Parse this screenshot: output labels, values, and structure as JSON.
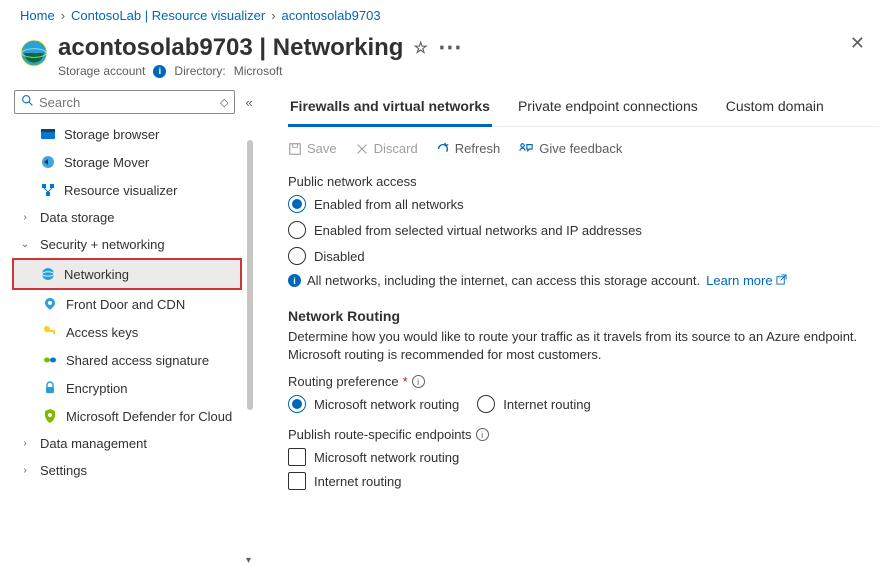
{
  "breadcrumb": {
    "home": "Home",
    "group": "ContosoLab | Resource visualizer",
    "resource": "acontosolab9703"
  },
  "header": {
    "title": "acontosolab9703 | Networking",
    "subtitle": "Storage account",
    "directory_label": "Directory:",
    "directory_value": "Microsoft"
  },
  "search": {
    "placeholder": "Search"
  },
  "sidebar": {
    "items": [
      {
        "label": "Storage browser"
      },
      {
        "label": "Storage Mover"
      },
      {
        "label": "Resource visualizer"
      },
      {
        "label": "Data storage"
      },
      {
        "label": "Security + networking"
      },
      {
        "label": "Networking"
      },
      {
        "label": "Front Door and CDN"
      },
      {
        "label": "Access keys"
      },
      {
        "label": "Shared access signature"
      },
      {
        "label": "Encryption"
      },
      {
        "label": "Microsoft Defender for Cloud"
      },
      {
        "label": "Data management"
      },
      {
        "label": "Settings"
      }
    ]
  },
  "tabs": {
    "firewalls": "Firewalls and virtual networks",
    "private": "Private endpoint connections",
    "custom": "Custom domain"
  },
  "toolbar": {
    "save": "Save",
    "discard": "Discard",
    "refresh": "Refresh",
    "feedback": "Give feedback"
  },
  "public_access": {
    "label": "Public network access",
    "opt1": "Enabled from all networks",
    "opt2": "Enabled from selected virtual networks and IP addresses",
    "opt3": "Disabled",
    "info": "All networks, including the internet, can access this storage account.",
    "learn": "Learn more"
  },
  "routing": {
    "heading": "Network Routing",
    "desc": "Determine how you would like to route your traffic as it travels from its source to an Azure endpoint. Microsoft routing is recommended for most customers.",
    "pref_label": "Routing preference",
    "opt_ms": "Microsoft network routing",
    "opt_inet": "Internet routing",
    "publish_label": "Publish route-specific endpoints",
    "chk_ms": "Microsoft network routing",
    "chk_inet": "Internet routing"
  }
}
